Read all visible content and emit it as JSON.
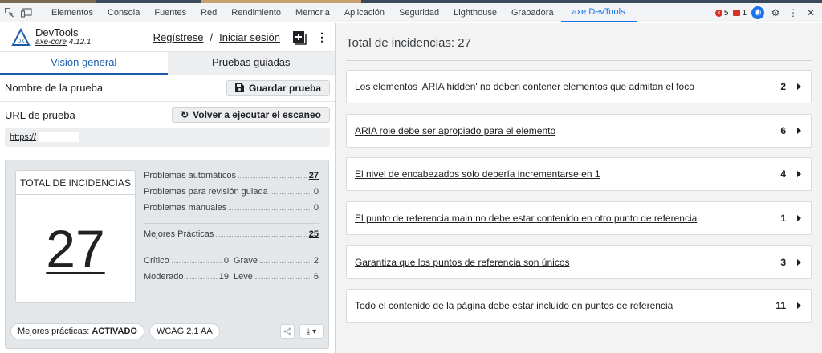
{
  "devtools": {
    "tabs": [
      "Elementos",
      "Consola",
      "Fuentes",
      "Red",
      "Rendimiento",
      "Memoria",
      "Aplicación",
      "Seguridad",
      "Lighthouse",
      "Grabadora",
      "axe DevTools"
    ],
    "errors_count": "5",
    "warnings_count": "1"
  },
  "header": {
    "brand": "DevTools",
    "core_name": "axe-core",
    "core_version": "4.12.1",
    "register": "Regístrese",
    "separator": "/",
    "login": "Iniciar sesión"
  },
  "tabs": {
    "overview": "Visión general",
    "guided": "Pruebas guiadas"
  },
  "test_name": {
    "label": "Nombre de la prueba",
    "save_button": "Guardar prueba"
  },
  "test_url": {
    "label": "URL de prueba",
    "rescan_button": "Volver a ejecutar el escaneo",
    "value": "https://"
  },
  "summary": {
    "total_title": "TOTAL DE INCIDENCIAS",
    "total": "27",
    "automatic_label": "Problemas automáticos",
    "automatic_value": "27",
    "guided_label": "Problemas para revisión guiada",
    "guided_value": "0",
    "manual_label": "Problemas manuales",
    "manual_value": "0",
    "best_label": "Mejores Prácticas",
    "best_value": "25",
    "critical_label": "Crítico",
    "critical_value": "0",
    "serious_label": "Grave",
    "serious_value": "2",
    "moderate_label": "Moderado",
    "moderate_value": "19",
    "minor_label": "Leve",
    "minor_value": "6"
  },
  "footer": {
    "best_practices_label": "Mejores prácticas:",
    "best_practices_state": "ACTIVADO",
    "standard": "WCAG 2.1 AA"
  },
  "results": {
    "title": "Total de incidencias: 27",
    "issues": [
      {
        "text": "Los elementos 'ARIA hidden' no deben contener elementos que admitan el foco",
        "count": "2"
      },
      {
        "text": "ARIA role debe ser apropiado para el elemento",
        "count": "6"
      },
      {
        "text": "El nivel de encabezados solo debería incrementarse en 1",
        "count": "4"
      },
      {
        "text": "El punto de referencia main no debe estar contenido en otro punto de referencia",
        "count": "1"
      },
      {
        "text": "Garantiza que los puntos de referencia son únicos",
        "count": "3"
      },
      {
        "text": "Todo el contenido de la página debe estar incluido en puntos de referencia",
        "count": "11"
      }
    ]
  }
}
